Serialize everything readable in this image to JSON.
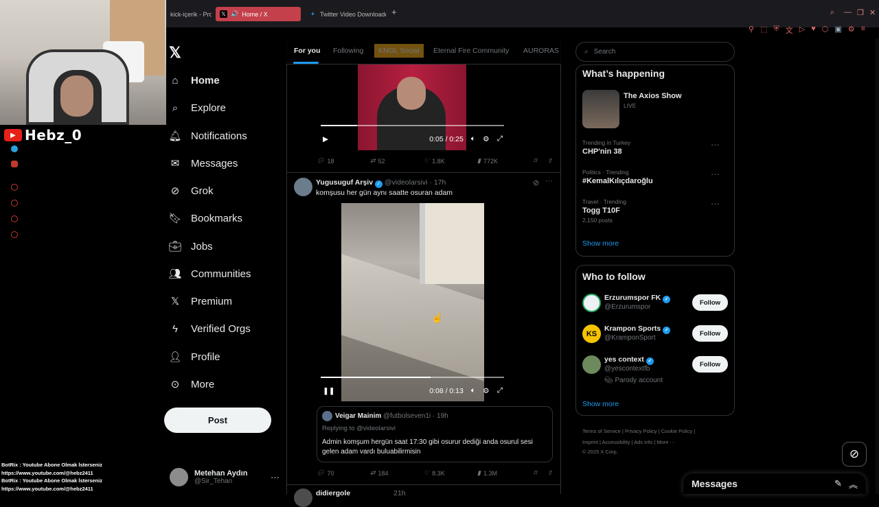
{
  "stream": {
    "streamer_name": "Hebz_0",
    "chat": [
      "BotRix : Youtube Abone Olmak İsterseniz",
      "https://www.youtube.com/@hebz2411",
      "BotRix : Youtube Abone Olmak İsterseniz",
      "https://www.youtube.com/@hebz2411"
    ]
  },
  "browser": {
    "tabs": [
      {
        "label": "kick-içerik - Pro",
        "icon": "document-icon"
      },
      {
        "label": "Home / X",
        "icon": "x-logo-icon",
        "active": true
      },
      {
        "label": "Twitter Video Downloade",
        "icon": "twitter-bird-icon"
      }
    ],
    "accent": "#c4404a"
  },
  "nav": {
    "items": [
      {
        "label": "Home",
        "icon": "home-icon"
      },
      {
        "label": "Explore",
        "icon": "search-icon"
      },
      {
        "label": "Notifications",
        "icon": "bell-icon"
      },
      {
        "label": "Messages",
        "icon": "envelope-icon"
      },
      {
        "label": "Grok",
        "icon": "grok-icon"
      },
      {
        "label": "Bookmarks",
        "icon": "bookmark-icon"
      },
      {
        "label": "Jobs",
        "icon": "briefcase-icon"
      },
      {
        "label": "Communities",
        "icon": "people-icon"
      },
      {
        "label": "Premium",
        "icon": "x-logo-icon"
      },
      {
        "label": "Verified Orgs",
        "icon": "lightning-icon"
      },
      {
        "label": "Profile",
        "icon": "person-icon"
      },
      {
        "label": "More",
        "icon": "more-circle-icon"
      }
    ],
    "post_label": "Post",
    "account": {
      "name": "Metehan Aydın",
      "handle": "@Sir_Tehan"
    }
  },
  "timeline": {
    "tabs": [
      "For you",
      "Following",
      "KNGL Social",
      "Eternal Fire Community",
      "AURORAS"
    ],
    "post1": {
      "video_time": "0:05 / 0:25",
      "progress": 0.2,
      "replies": "18",
      "reposts": "52",
      "likes": "1.8K",
      "views": "772K"
    },
    "post2": {
      "author": "Yugusuguf Arşiv",
      "handle": "@videolarsivi",
      "time": "· 17h",
      "text": "komşusu her gün aynı saatte osuran adam",
      "video_time": "0:08 / 0:13",
      "progress": 0.6,
      "quote": {
        "author": "Veigar Mainim",
        "handle": "@futbolseven1i",
        "time": "· 19h",
        "replying": "Replying to @videolarsivi",
        "text_line1": "Admin komşum hergün saat 17:30 gibi osurur dediği anda osurul sesi",
        "text_line2": "gelen adam vardı buluabilirmisin"
      },
      "replies": "70",
      "reposts": "184",
      "likes": "8.3K",
      "views": "1.3M"
    },
    "post3": {
      "author": "didiergole",
      "time": "21h"
    }
  },
  "right": {
    "search_placeholder": "Search",
    "happening": {
      "title": "What’s happening",
      "live": {
        "title": "The Axios Show",
        "status": "LIVE"
      },
      "trends": [
        {
          "meta": "Trending in Turkey",
          "title": "CHP'nin 38",
          "posts": ""
        },
        {
          "meta": "Politics · Trending",
          "title": "#KemalKılıçdaroğlu",
          "posts": ""
        },
        {
          "meta": "Travel · Trending",
          "title": "Togg T10F",
          "posts": "2,150 posts"
        }
      ],
      "show_more": "Show more"
    },
    "who_to_follow": {
      "title": "Who to follow",
      "accounts": [
        {
          "name": "Erzurumspor FK",
          "handle": "@Erzurumspor",
          "note": ""
        },
        {
          "name": "Krampon Sports",
          "handle": "@KramponSport",
          "note": ""
        },
        {
          "name": "yes context",
          "handle": "@yescontextfb",
          "note": "Parody account"
        }
      ],
      "follow_label": "Follow",
      "show_more": "Show more"
    },
    "footer": {
      "line1": "Terms of Service  |  Privacy Policy  |  Cookie Policy  |",
      "line2": "Imprint  |  Accessibility  |  Ads info  |  More ···",
      "line3": "© 2025 X Corp."
    }
  },
  "messages_drawer": {
    "title": "Messages"
  },
  "colors": {
    "link": "#1d9bf0",
    "border": "#2f3336",
    "muted": "#71767b"
  }
}
